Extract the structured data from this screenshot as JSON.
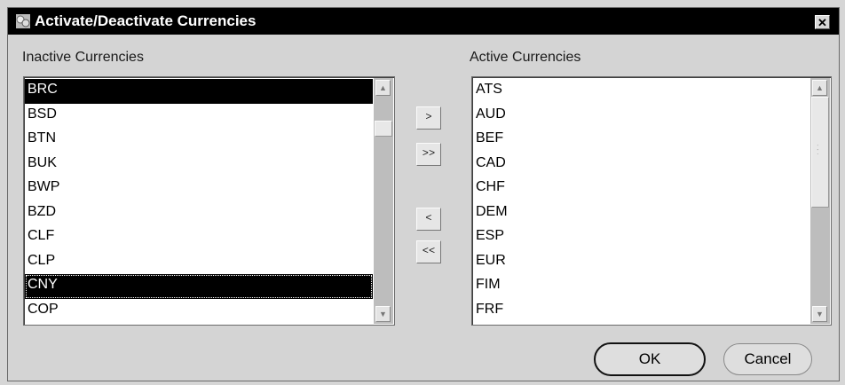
{
  "window": {
    "title": "Activate/Deactivate Currencies",
    "close_glyph": "✕"
  },
  "inactive": {
    "label": "Inactive Currencies",
    "items": [
      "BRC",
      "BSD",
      "BTN",
      "BUK",
      "BWP",
      "BZD",
      "CLF",
      "CLP",
      "CNY",
      "COP"
    ],
    "selected": [
      "BRC",
      "CNY"
    ],
    "focused": "CNY"
  },
  "active": {
    "label": "Active Currencies",
    "items": [
      "ATS",
      "AUD",
      "BEF",
      "CAD",
      "CHF",
      "DEM",
      "ESP",
      "EUR",
      "FIM",
      "FRF"
    ]
  },
  "buttons": {
    "move_one_right": ">",
    "move_all_right": ">>",
    "move_one_left": "<",
    "move_all_left": "<<",
    "ok": "OK",
    "cancel": "Cancel"
  },
  "icons": {
    "app": "currency-dialog-icon",
    "scroll_up": "arrow-up-icon",
    "scroll_down": "arrow-down-icon"
  }
}
